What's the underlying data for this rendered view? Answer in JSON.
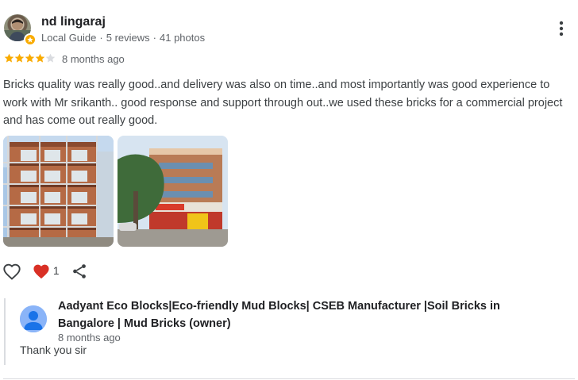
{
  "review": {
    "reviewer_name": "nd lingaraj",
    "reviewer_badge": "Local Guide",
    "reviewer_reviews": "5 reviews",
    "reviewer_photos": "41 photos",
    "rating": 4,
    "rating_max": 5,
    "time": "8 months ago",
    "text": "Bricks quality was really good..and delivery was also on time..and most importantly was good experience to work with Mr srikanth.. good response and support through out..we used these bricks for a commercial project and has come out really good.",
    "photos": [
      "building-under-construction-photo",
      "completed-commercial-building-photo"
    ],
    "like_icon": "heart-outline-icon",
    "reaction_icon": "red-heart-icon",
    "reaction_count": "1",
    "share_icon": "share-icon",
    "menu_icon": "more-vert-icon"
  },
  "owner_reply": {
    "owner_name": "Aadyant Eco Blocks|Eco-friendly Mud Blocks| CSEB Manufacturer |Soil Bricks in Bangalore | Mud Bricks (owner)",
    "time": "8 months ago",
    "text": "Thank you sir"
  },
  "colors": {
    "star": "#f9ab00",
    "heart": "#d93025",
    "secondary_text": "#5f6368",
    "owner_avatar": "#8ab4f8"
  }
}
